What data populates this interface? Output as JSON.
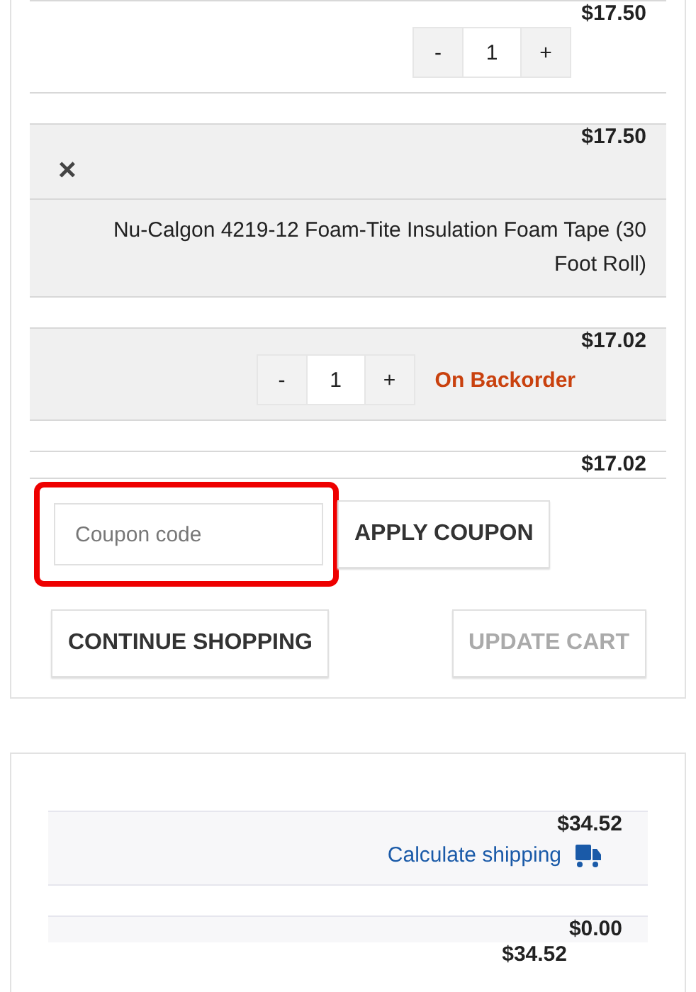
{
  "cart_rows": [
    {
      "kind": "quantity",
      "shaded": false,
      "price": "$17.50",
      "minus": "-",
      "quantity": "1",
      "plus": "+"
    },
    {
      "kind": "remove",
      "shaded": true,
      "price": "$17.50",
      "remove": "×"
    },
    {
      "kind": "name",
      "shaded": true,
      "name": "Nu-Calgon 4219-12 Foam-Tite Insulation Foam Tape (30 Foot Roll)"
    },
    {
      "kind": "quantity",
      "shaded": true,
      "price": "$17.02",
      "minus": "-",
      "quantity": "1",
      "plus": "+",
      "status": "On Backorder"
    },
    {
      "kind": "subtotal",
      "shaded": false,
      "price": "$17.02"
    }
  ],
  "coupon": {
    "placeholder": "Coupon code",
    "highlighted": true,
    "apply": "APPLY COUPON"
  },
  "actions": [
    {
      "label": "CONTINUE SHOPPING",
      "disabled": false
    },
    {
      "label": "UPDATE CART",
      "disabled": true
    }
  ],
  "totals": {
    "subtotal": "$34.52",
    "shipping_link": "Calculate shipping",
    "tax": "$0.00",
    "total": "$34.52"
  }
}
